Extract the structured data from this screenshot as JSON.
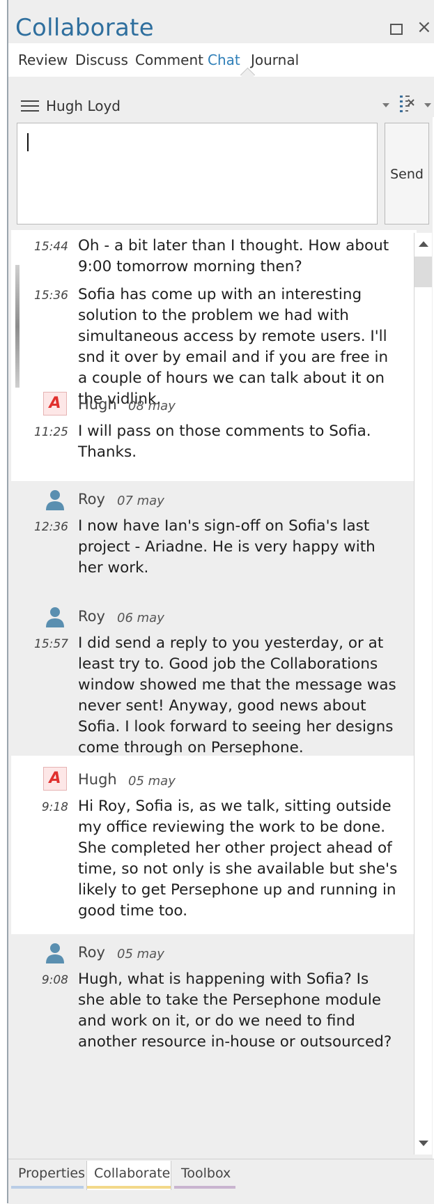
{
  "window": {
    "title": "Collaborate",
    "restore_icon": "restore-icon",
    "close_glyph": "×"
  },
  "tabs": [
    {
      "label": "Review",
      "active": false
    },
    {
      "label": "Discuss",
      "active": false
    },
    {
      "label": "Comment",
      "active": false
    },
    {
      "label": "Chat",
      "active": true
    },
    {
      "label": "Journal",
      "active": false
    }
  ],
  "chat_header": {
    "user": "Hugh Loyd"
  },
  "composer": {
    "value": "",
    "send_label": "Send"
  },
  "messages": {
    "m1": {
      "time": "15:44",
      "text": "Oh - a bit later than I thought. How about 9:00 tomorrow morning then?"
    },
    "m2": {
      "time": "15:36",
      "text": "Sofia has come up with an interesting solution to the problem we had with simultaneous access by remote users. I'll snd it over by email and if you are free in a couple of hours we can talk about it on the vidlink."
    },
    "g3": {
      "sender": "Hugh",
      "date": "08 may",
      "time": "11:25",
      "text": "I will pass on those comments to Sofia. Thanks."
    },
    "g4": {
      "sender": "Roy",
      "date": "07 may",
      "time": "12:36",
      "text": "I now have Ian's sign-off on Sofia's last project - Ariadne. He is very happy with her work."
    },
    "g5": {
      "sender": "Roy",
      "date": "06 may",
      "time": "15:57",
      "text": "I did send a reply to you yesterday, or at least try to. Good job the Collaborations window showed me that the message was never sent! Anyway, good news about Sofia. I look forward to seeing her designs come through on Persephone."
    },
    "g6": {
      "sender": "Hugh",
      "date": "05 may",
      "time": "9:18",
      "text": "Hi Roy, Sofia is, as we talk, sitting outside my office reviewing the work to be done. She completed her other project ahead of time, so not only is she available but she's likely to get Persephone up and running in good time too."
    },
    "g7": {
      "sender": "Roy",
      "date": "05 may",
      "time": "9:08",
      "text": "Hugh, what is happening with Sofia? Is she able to take the Persephone module and work on it, or do we need to find another resource in-house or outsourced?"
    }
  },
  "avatar_glyph": "A",
  "bottom_tabs": [
    {
      "label": "Properties",
      "underline": "#b9cde6"
    },
    {
      "label": "Collaborate",
      "underline": "#f3d98a",
      "active": true
    },
    {
      "label": "Toolbox",
      "underline": "#c9b4cf"
    }
  ],
  "colors": {
    "accent": "#2f7fb8",
    "title": "#2f6f9e",
    "user_avatar": "#5a8fb0",
    "ea_avatar": "#e0302e"
  }
}
